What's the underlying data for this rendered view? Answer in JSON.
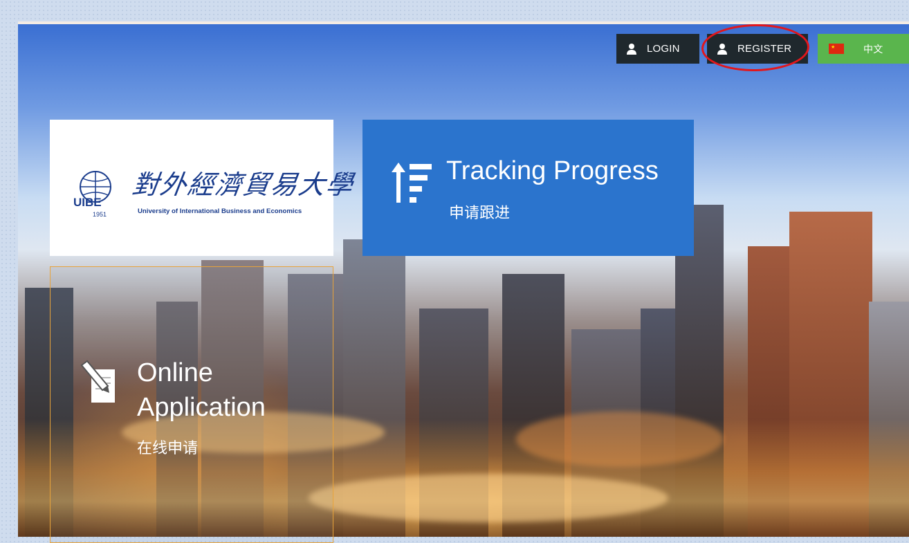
{
  "header": {
    "login_label": "LOGIN",
    "register_label": "REGISTER",
    "language_label": "中文"
  },
  "logo": {
    "chinese_name": "對外經濟貿易大學",
    "english_name": "University of International Business and Economics",
    "seal_letters": "UIBE",
    "seal_year": "1951"
  },
  "tiles": {
    "tracking": {
      "title": "Tracking Progress",
      "subtitle": "申请跟进"
    },
    "application": {
      "title": "Online Application",
      "subtitle": "在线申请"
    }
  },
  "colors": {
    "dark_button": "#1f282d",
    "language_button": "#5ab54d",
    "tracking_tile": "#2b74cd",
    "application_border": "#e8a33a",
    "annotation_circle": "#e3161b"
  },
  "icons": {
    "login": "user-icon",
    "register": "user-icon",
    "language": "china-flag-icon",
    "tracking": "sort-ascending-icon",
    "application": "edit-document-icon"
  }
}
